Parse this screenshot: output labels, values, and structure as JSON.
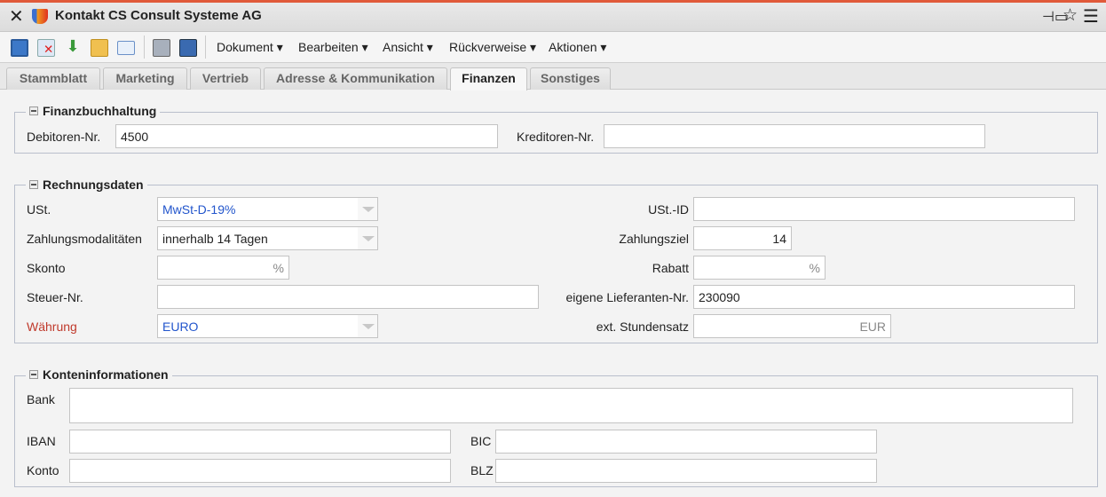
{
  "window": {
    "title": "Kontakt CS Consult Systeme AG"
  },
  "toolbar": {
    "icons": [
      "save-icon",
      "delete-icon",
      "download-icon",
      "copy-icon",
      "mail-icon",
      "print-icon",
      "book-icon"
    ],
    "menus": [
      "Dokument",
      "Bearbeiten",
      "Ansicht",
      "Rückverweise",
      "Aktionen"
    ]
  },
  "tabs": [
    "Stammblatt",
    "Marketing",
    "Vertrieb",
    "Adresse & Kommunikation",
    "Finanzen",
    "Sonstiges"
  ],
  "active_tab": "Finanzen",
  "finanzbuchhaltung": {
    "legend": "Finanzbuchhaltung",
    "debitoren_label": "Debitoren-Nr.",
    "debitoren_value": "4500",
    "kreditoren_label": "Kreditoren-Nr.",
    "kreditoren_value": ""
  },
  "rechnungsdaten": {
    "legend": "Rechnungsdaten",
    "ust_label": "USt.",
    "ust_value": "MwSt-D-19%",
    "ustid_label": "USt.-ID",
    "ustid_value": "",
    "zahlmod_label": "Zahlungsmodalitäten",
    "zahlmod_value": "innerhalb 14 Tagen",
    "zahlziel_label": "Zahlungsziel",
    "zahlziel_value": "14",
    "skonto_label": "Skonto",
    "skonto_unit": "%",
    "rabatt_label": "Rabatt",
    "rabatt_unit": "%",
    "steuer_label": "Steuer-Nr.",
    "steuer_value": "",
    "lief_label": "eigene Lieferanten-Nr.",
    "lief_value": "230090",
    "waehrung_label": "Währung",
    "waehrung_value": "EURO",
    "stundensatz_label": "ext. Stundensatz",
    "stundensatz_unit": "EUR"
  },
  "konten": {
    "legend": "Konteninformationen",
    "bank_label": "Bank",
    "iban_label": "IBAN",
    "bic_label": "BIC",
    "konto_label": "Konto",
    "blz_label": "BLZ"
  },
  "colors": {
    "accent": "#e05a3a",
    "link": "#2255cc",
    "required": "#c0392b"
  }
}
